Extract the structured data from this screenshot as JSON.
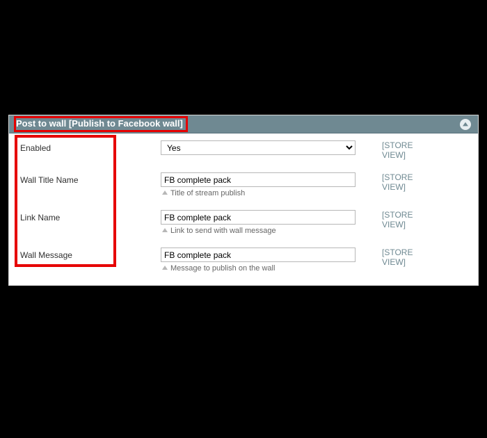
{
  "section": {
    "title": "Post to wall [Publish to Facebook wall]"
  },
  "fields": {
    "enabled": {
      "label": "Enabled",
      "value": "Yes",
      "scope1": "[STORE",
      "scope2": "VIEW]"
    },
    "wall_title": {
      "label": "Wall Title Name",
      "value": "FB complete pack",
      "note": "Title of stream publish",
      "scope1": "[STORE",
      "scope2": "VIEW]"
    },
    "link_name": {
      "label": "Link Name",
      "value": "FB complete pack",
      "note": "Link to send with wall message",
      "scope1": "[STORE",
      "scope2": "VIEW]"
    },
    "wall_message": {
      "label": "Wall Message",
      "value": "FB complete pack",
      "note": "Message to publish on the wall",
      "scope1": "[STORE",
      "scope2": "VIEW]"
    }
  }
}
